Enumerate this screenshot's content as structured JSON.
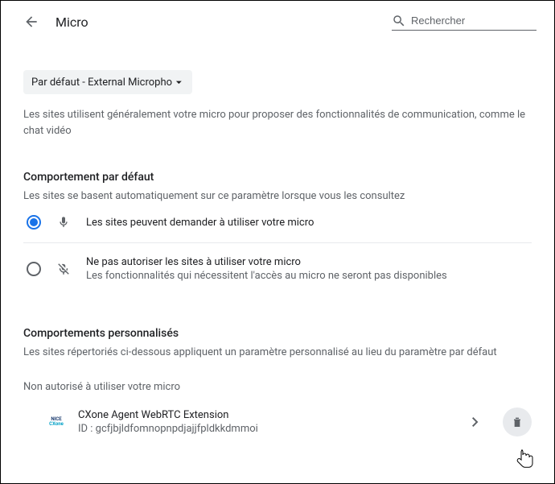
{
  "header": {
    "title": "Micro",
    "search_placeholder": "Rechercher"
  },
  "dropdown": {
    "selected": "Par défaut - External Microphone"
  },
  "intro_desc": "Les sites utilisent généralement votre micro pour proposer des fonctionnalités de communication, comme le chat vidéo",
  "default_behavior": {
    "title": "Comportement par défaut",
    "desc": "Les sites se basent automatiquement sur ce paramètre lorsque vous les consultez",
    "option_allow": {
      "label": "Les sites peuvent demander à utiliser votre micro",
      "selected": true
    },
    "option_block": {
      "label": "Ne pas autoriser les sites à utiliser votre micro",
      "sub": "Les fonctionnalités qui nécessitent l'accès au micro ne seront pas disponibles",
      "selected": false
    }
  },
  "custom_behavior": {
    "title": "Comportements personnalisés",
    "desc": "Les sites répertoriés ci-dessous appliquent un paramètre personnalisé au lieu du paramètre par défaut"
  },
  "blocked_section": {
    "heading": "Non autorisé à utiliser votre micro",
    "items": [
      {
        "icon_top": "NICE",
        "icon_bottom": "CXone",
        "name": "CXone Agent WebRTC Extension",
        "id_label": "ID : gcfjbjldfomnopnpdjajjfpldkkdmmoi"
      }
    ]
  }
}
